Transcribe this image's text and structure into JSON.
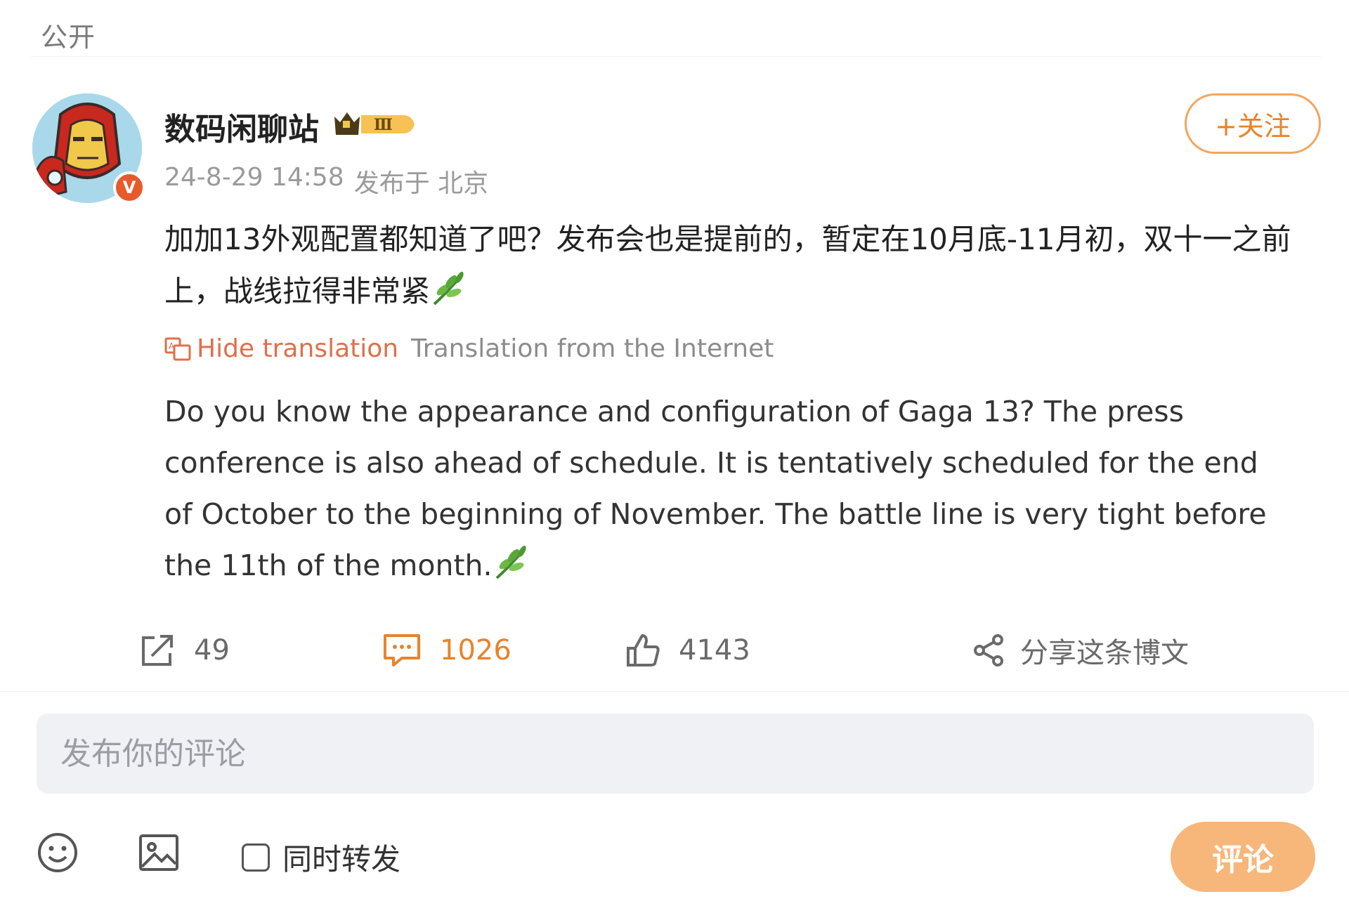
{
  "header": {
    "visibility": "公开"
  },
  "post": {
    "author": {
      "name": "数码闲聊站",
      "vip_level": "Ⅲ",
      "verified_mark": "V"
    },
    "timestamp": "24-8-29 14:58",
    "location": "发布于 北京",
    "follow_label": "+关注",
    "text": "加加13外观配置都知道了吧？发布会也是提前的，暂定在10月底-11月初，双十一之前上，战线拉得非常紧",
    "hide_translation_label": "Hide translation",
    "translation_source": "Translation from the Internet",
    "translation": "Do you know the appearance and configuration of Gaga 13? The press conference is also ahead of schedule. It is tentatively scheduled for the end of October to the beginning of November. The battle line is very tight before the 11th of the month."
  },
  "actions": {
    "repost_count": "49",
    "comment_count": "1026",
    "like_count": "4143",
    "share_label": "分享这条博文"
  },
  "comment_box": {
    "placeholder": "发布你的评论",
    "repost_label": "同时转发",
    "submit_label": "评论"
  },
  "icons": [
    "emoji-icon",
    "image-icon",
    "repost-icon",
    "comment-icon",
    "like-icon",
    "share-icon",
    "leaf-emoji-icon",
    "translate-icon",
    "crown-icon"
  ],
  "colors": {
    "accent": "#e8832a",
    "submit_bg": "#f7b67a",
    "link": "#e06f4a"
  }
}
